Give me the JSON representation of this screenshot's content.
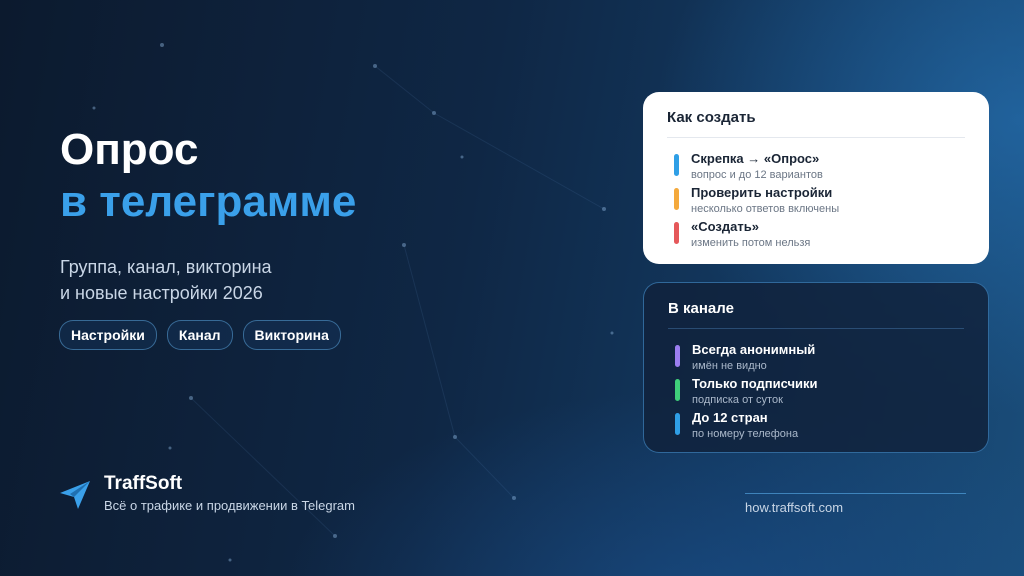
{
  "title": {
    "line1": "Опрос",
    "line2": "в телеграмме"
  },
  "subtitle": {
    "line1": "Группа, канал, викторина",
    "line2": "и новые настройки 2026"
  },
  "tags": [
    "Настройки",
    "Канал",
    "Викторина"
  ],
  "brand": {
    "name": "TraffSoft",
    "tagline": "Всё о трафике и продвижении в Telegram",
    "icon": "telegram-plane-icon"
  },
  "url": "how.traffsoft.com",
  "cards": {
    "how": {
      "title": "Как создать",
      "items": [
        {
          "title": "Скрепка → «Опрос»",
          "sub": "вопрос и до 12 вариантов",
          "color": "#2f9fe6"
        },
        {
          "title": "Проверить настройки",
          "sub": "несколько ответов включены",
          "color": "#f4a93c"
        },
        {
          "title": "«Создать»",
          "sub": "изменить потом нельзя",
          "color": "#e5585a"
        }
      ]
    },
    "channel": {
      "title": "В канале",
      "items": [
        {
          "title": "Всегда анонимный",
          "sub": "имён не видно",
          "color": "#9b7ef0"
        },
        {
          "title": "Только подписчики",
          "sub": "подписка от суток",
          "color": "#3fcf7a"
        },
        {
          "title": "До 12 стран",
          "sub": "по номеру телефона",
          "color": "#2f9fe6"
        }
      ]
    }
  },
  "colors": {
    "accent": "#3aa0ea",
    "background": "#0f2745"
  }
}
